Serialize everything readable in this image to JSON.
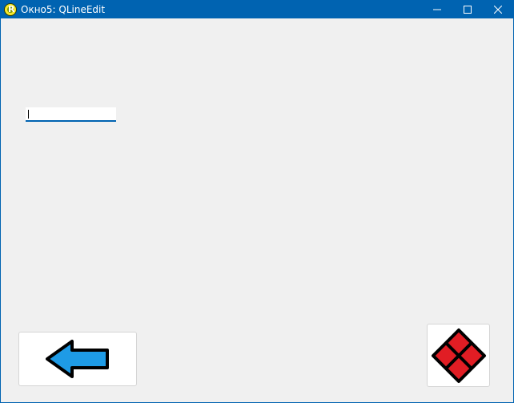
{
  "window": {
    "title": "Окно5: QLineEdit",
    "app_icon_glyph": "R",
    "controls": {
      "minimize_icon": "minimize-icon",
      "maximize_icon": "maximize-icon",
      "close_icon": "close-icon"
    }
  },
  "main": {
    "line_edit": {
      "value": "",
      "placeholder": ""
    },
    "back_button": {
      "icon": "left-arrow-icon"
    },
    "right_button": {
      "icon": "red-diamond-grid-icon"
    }
  },
  "colors": {
    "titlebar": "#0063b1",
    "window_bg": "#f0f0f0",
    "arrow_fill": "#1e9be6",
    "diamond_fill": "#e11d24"
  }
}
